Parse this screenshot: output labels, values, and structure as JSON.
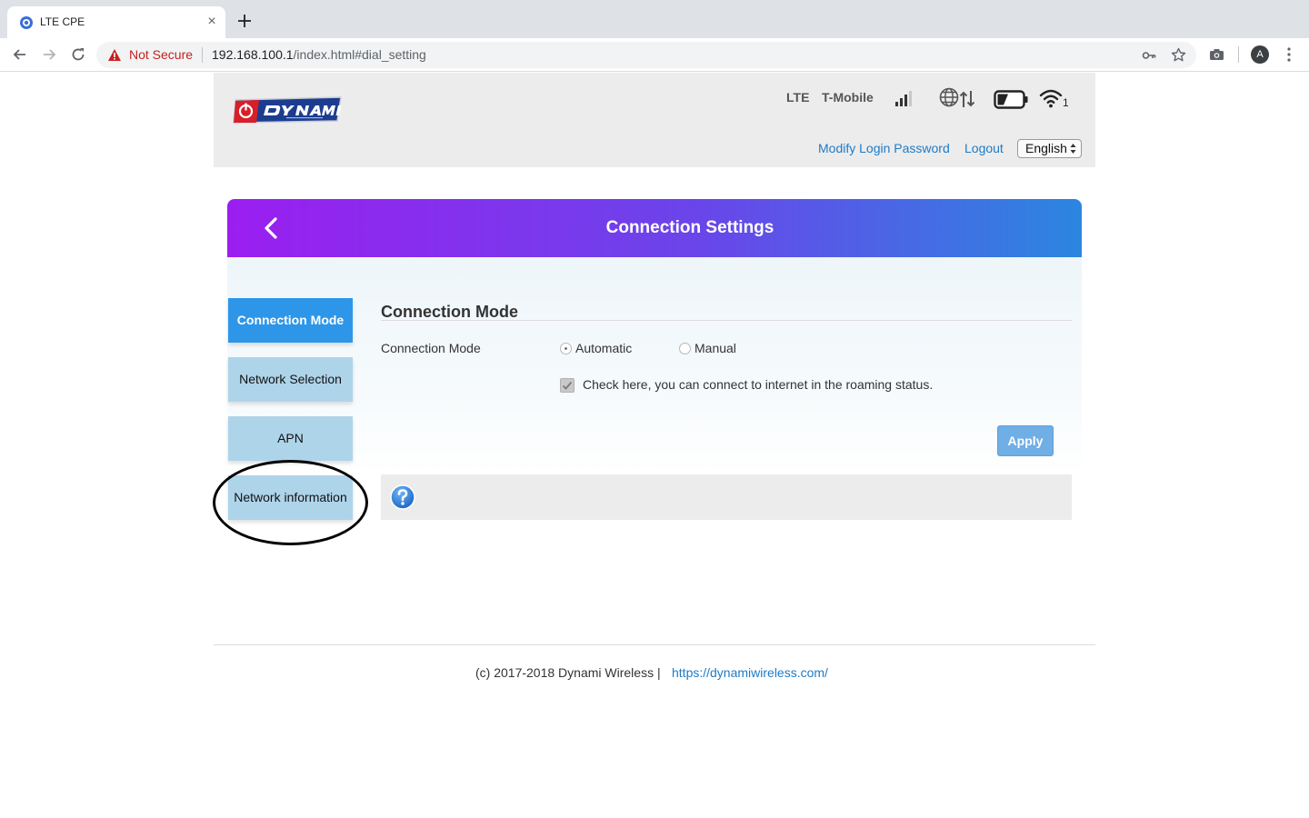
{
  "browser": {
    "tab_title": "LTE CPE",
    "tab_close": "×",
    "security_label": "Not Secure",
    "url_host": "192.168.100.1",
    "url_path": "/index.html#dial_setting",
    "profile_initial": "A"
  },
  "header": {
    "network_type": "LTE",
    "carrier": "T-Mobile",
    "wifi_clients": "1",
    "modify_password_label": "Modify Login Password",
    "logout_label": "Logout",
    "language_selected": "English"
  },
  "panel": {
    "title": "Connection Settings"
  },
  "sidebar": {
    "items": [
      {
        "label": "Connection Mode"
      },
      {
        "label": "Network Selection"
      },
      {
        "label": "APN"
      },
      {
        "label": "Network information"
      }
    ]
  },
  "form": {
    "section_title": "Connection Mode",
    "mode_label": "Connection Mode",
    "option_automatic": "Automatic",
    "option_manual": "Manual",
    "roaming_label": "Check here, you can connect to internet in the roaming status.",
    "apply_label": "Apply"
  },
  "footer": {
    "copyright": "(c) 2017-2018 Dynami Wireless  |",
    "link": "https://dynamiwireless.com/"
  },
  "colors": {
    "accent_blue": "#2e96e8",
    "side_item_bg": "#aed4ea",
    "link_blue": "#1e7bc6",
    "gradient_start": "#9b1ef0",
    "gradient_end": "#2b86e0"
  }
}
